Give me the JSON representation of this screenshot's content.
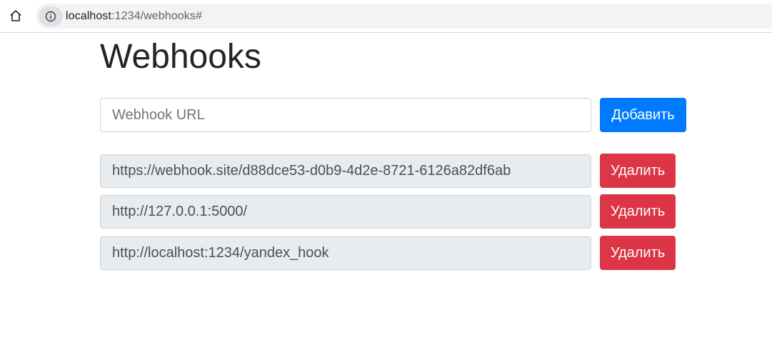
{
  "browser": {
    "url_host": "localhost",
    "url_rest": ":1234/webhooks#",
    "home_icon": "home-icon",
    "info_icon": "info-icon"
  },
  "page": {
    "title": "Webhooks"
  },
  "add_form": {
    "placeholder": "Webhook URL",
    "value": "",
    "button_label": "Добавить"
  },
  "webhooks": [
    {
      "url": "https://webhook.site/d88dce53-d0b9-4d2e-8721-6126a82df6ab",
      "delete_label": "Удалить"
    },
    {
      "url": "http://127.0.0.1:5000/",
      "delete_label": "Удалить"
    },
    {
      "url": "http://localhost:1234/yandex_hook",
      "delete_label": "Удалить"
    }
  ],
  "colors": {
    "primary": "#007bff",
    "danger": "#dc3545",
    "readonly_bg": "#e9ecef"
  }
}
